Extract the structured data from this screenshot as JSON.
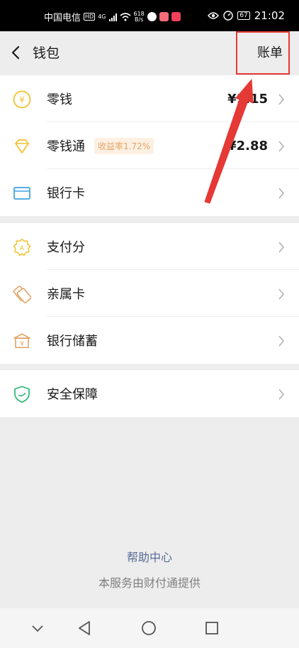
{
  "status_bar": {
    "carrier": "中国电信",
    "hd": "HD",
    "network": "4G",
    "speed_value": "618",
    "speed_unit": "B/s",
    "battery": "67",
    "time": "21:02"
  },
  "nav": {
    "title": "钱包",
    "bill_label": "账单"
  },
  "groups": [
    {
      "items": [
        {
          "label": "零钱",
          "value": "¥1.15",
          "icon": "yuan-coin-icon"
        },
        {
          "label": "零钱通",
          "badge": "收益率1.72%",
          "value": "¥2.88",
          "icon": "diamond-icon"
        },
        {
          "label": "银行卡",
          "icon": "bank-card-icon"
        }
      ]
    },
    {
      "items": [
        {
          "label": "支付分",
          "icon": "pay-score-badge-icon"
        },
        {
          "label": "亲属卡",
          "icon": "family-card-icon"
        },
        {
          "label": "银行储蓄",
          "icon": "bank-savings-icon"
        }
      ]
    },
    {
      "items": [
        {
          "label": "安全保障",
          "icon": "shield-icon"
        }
      ]
    }
  ],
  "footer": {
    "help": "帮助中心",
    "provider": "本服务由财付通提供"
  },
  "colors": {
    "accent_red": "#e53935",
    "link_blue": "#576b95",
    "icon_yellow": "#f2c12e",
    "icon_orange": "#e3a464",
    "icon_blue": "#3ea0e0",
    "icon_green": "#2bb673"
  }
}
